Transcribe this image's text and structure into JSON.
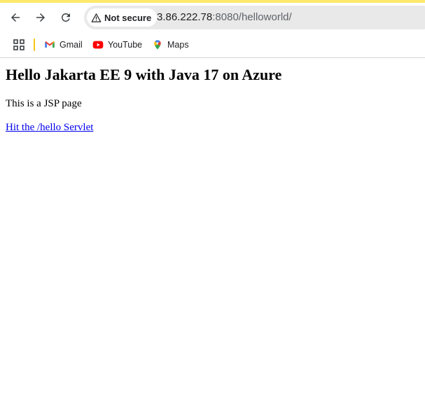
{
  "browser": {
    "accent_color": "#fde96c",
    "nav": {
      "back_icon": "arrow-left-icon",
      "forward_icon": "arrow-right-icon",
      "reload_icon": "reload-icon"
    },
    "security_chip": {
      "icon": "warning-triangle-icon",
      "label": "Not secure"
    },
    "url": {
      "host": "3.86.222.78",
      "rest": ":8080/helloworld/"
    },
    "bookmarks": [
      {
        "label": "Gmail",
        "icon": "gmail-icon"
      },
      {
        "label": "YouTube",
        "icon": "youtube-icon"
      },
      {
        "label": "Maps",
        "icon": "maps-icon"
      }
    ]
  },
  "page": {
    "heading": "Hello Jakarta EE 9 with Java 17 on Azure",
    "paragraph": "This is a JSP page",
    "link_text": "Hit the /hello Servlet",
    "link_color": "#0000ee"
  }
}
